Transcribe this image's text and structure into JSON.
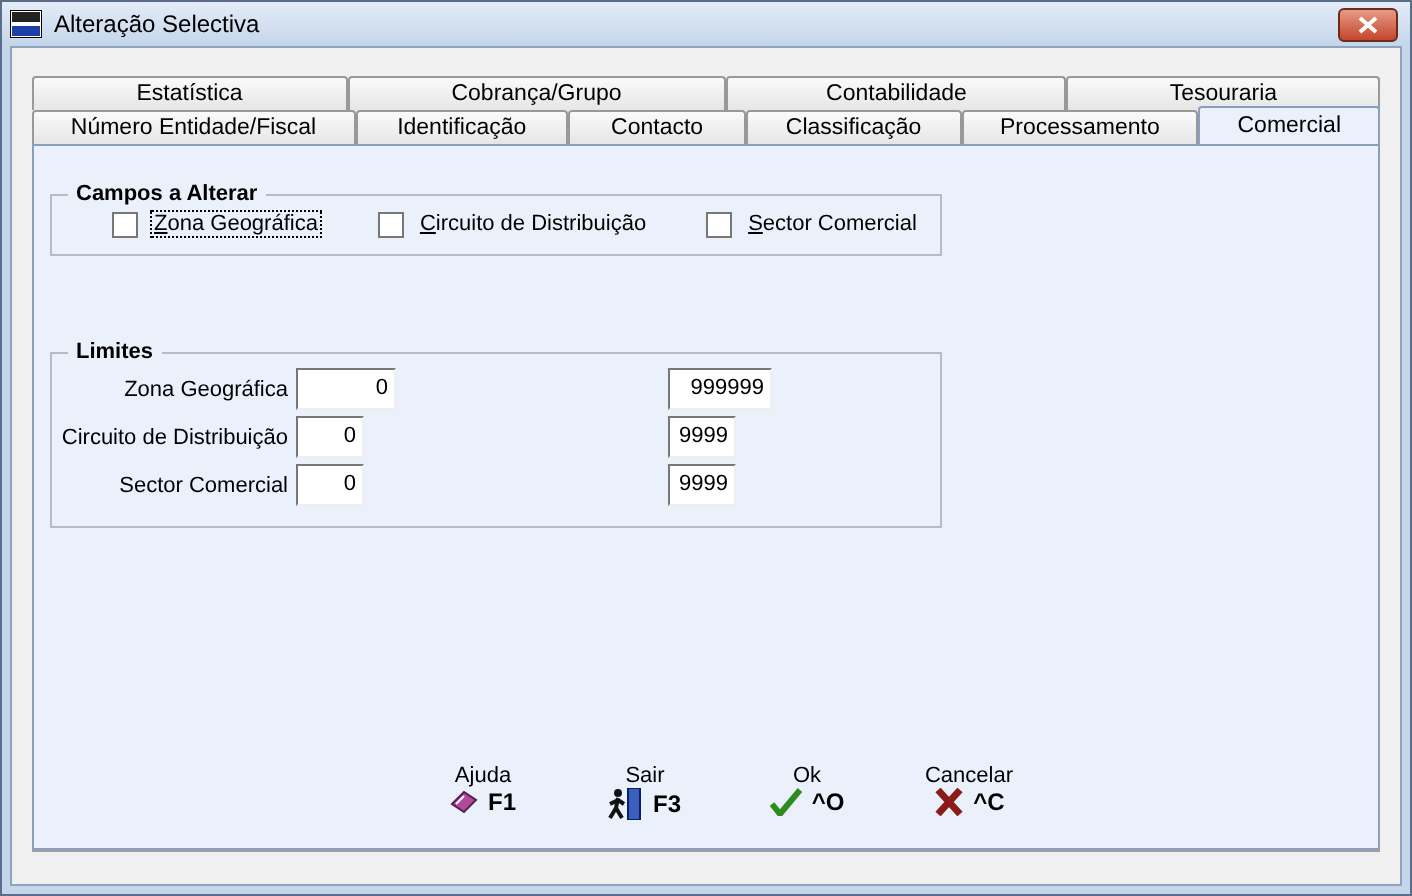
{
  "window": {
    "title": "Alteração Selectiva"
  },
  "tabs": {
    "back_row": [
      {
        "label": "Estatística",
        "selected": false
      },
      {
        "label": "Cobrança/Grupo",
        "selected": false
      },
      {
        "label": "Contabilidade",
        "selected": false
      },
      {
        "label": "Tesouraria",
        "selected": false
      }
    ],
    "front_row": [
      {
        "label": "Número Entidade/Fiscal",
        "selected": false
      },
      {
        "label": "Identificação",
        "selected": false
      },
      {
        "label": "Contacto",
        "selected": false
      },
      {
        "label": "Classificação",
        "selected": false
      },
      {
        "label": "Processamento",
        "selected": false
      },
      {
        "label": "Comercial",
        "selected": true
      }
    ]
  },
  "campos": {
    "title": "Campos a Alterar",
    "checkboxes": [
      {
        "label": "Zona Geográfica",
        "checked": false,
        "focused": true
      },
      {
        "label": "Circuito de Distribuição",
        "checked": false,
        "focused": false
      },
      {
        "label": "Sector Comercial",
        "checked": false,
        "focused": false
      }
    ]
  },
  "limites": {
    "title": "Limites",
    "rows": [
      {
        "label": "Zona Geográfica",
        "from": "0",
        "to": "999999"
      },
      {
        "label": "Circuito de Distribuição",
        "from": "0",
        "to": "9999"
      },
      {
        "label": "Sector Comercial",
        "from": "0",
        "to": "9999"
      }
    ]
  },
  "buttons": [
    {
      "kind": "help",
      "label": "Ajuda",
      "key": "F1"
    },
    {
      "kind": "exit",
      "label": "Sair",
      "key": "F3"
    },
    {
      "kind": "ok",
      "label": "Ok",
      "key": "^O"
    },
    {
      "kind": "cancel",
      "label": "Cancelar",
      "key": "^C"
    }
  ]
}
